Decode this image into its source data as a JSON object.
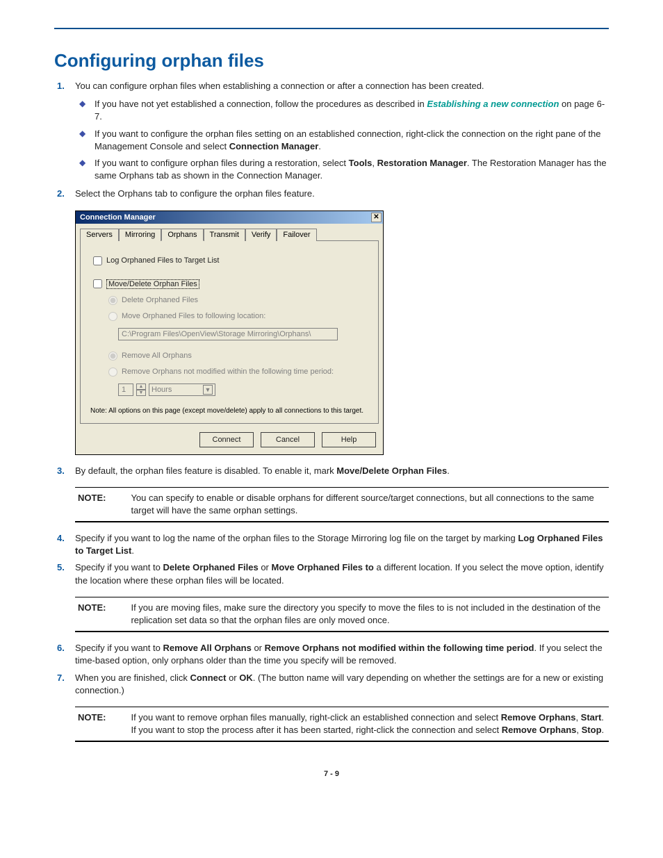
{
  "title": "Configuring orphan files",
  "page_number": "7 - 9",
  "steps": {
    "1": {
      "text": "You can configure orphan files when establishing a connection or after a connection has been created.",
      "bullets": {
        "a": {
          "pre": "If you have not yet established a connection, follow the procedures as described in ",
          "link": "Establishing a new connection",
          "post": " on page 6-7."
        },
        "b": {
          "pre": "If you want to configure the orphan files setting on an established connection, right-click the connection on the right pane of the Management Console and select ",
          "b1": "Connection Manager",
          "post": "."
        },
        "c": {
          "pre": "If you want to configure orphan files during a restoration, select ",
          "b1": "Tools",
          "mid": ", ",
          "b2": "Restoration Manager",
          "post": ". The Restoration Manager has the same Orphans tab as shown in the Connection Manager."
        }
      }
    },
    "2": {
      "text": "Select the Orphans tab to configure the orphan files feature."
    },
    "3": {
      "pre": "By default, the orphan files feature is disabled. To enable it, mark ",
      "b1": "Move/Delete Orphan Files",
      "post": "."
    },
    "4": {
      "pre": "Specify if you want to log the name of the orphan files to the Storage Mirroring log file on the target by marking ",
      "b1": "Log Orphaned Files to Target List",
      "post": "."
    },
    "5": {
      "pre": "Specify if you want to ",
      "b1": "Delete Orphaned Files",
      "mid1": " or ",
      "b2": "Move Orphaned Files to",
      "post": " a different location. If you select the move option, identify the location where these orphan files will be located."
    },
    "6": {
      "pre": "Specify if you want to ",
      "b1": "Remove All Orphans",
      "mid1": " or ",
      "b2": "Remove Orphans not modified within the following time period",
      "post": ". If you select the time-based option, only orphans older than the time you specify will be removed."
    },
    "7": {
      "pre": "When you are finished, click  ",
      "b1": "Connect",
      "mid1": " or ",
      "b2": "OK",
      "post": ". (The button name will vary depending on whether the settings are for a new or existing connection.)"
    }
  },
  "notes": {
    "label": "NOTE:",
    "n1": "You can specify to enable or disable orphans for different source/target connections, but all connections to the same target will have the same orphan settings.",
    "n2": "If you are moving files, make sure the directory you specify to move the files to is not included in the destination of the replication set data so that the orphan files are only moved once.",
    "n3": {
      "pre": "If you want to remove orphan files manually, right-click an established connection and select ",
      "b1": "Remove Orphans",
      "mid1": ", ",
      "b2": "Start",
      "mid2": ". If you want to stop the process after it has been started, right-click the connection and select ",
      "b3": "Remove Orphans",
      "mid3": ", ",
      "b4": "Stop",
      "post": "."
    }
  },
  "dialog": {
    "title": "Connection Manager",
    "tabs": [
      "Servers",
      "Mirroring",
      "Orphans",
      "Transmit",
      "Verify",
      "Failover"
    ],
    "chk_log": "Log Orphaned Files to Target List",
    "chk_move": "Move/Delete Orphan Files",
    "rad_delete": "Delete Orphaned Files",
    "rad_moveto": "Move Orphaned Files to following location:",
    "path_value": "C:\\Program Files\\OpenView\\Storage Mirroring\\Orphans\\",
    "rad_removeall": "Remove All Orphans",
    "rad_removetime": "Remove Orphans not modified within the following time period:",
    "time_value": "1",
    "time_unit": "Hours",
    "note": "Note: All options on this page (except move/delete) apply to all connections to this target.",
    "buttons": {
      "connect": "Connect",
      "cancel": "Cancel",
      "help": "Help"
    }
  }
}
